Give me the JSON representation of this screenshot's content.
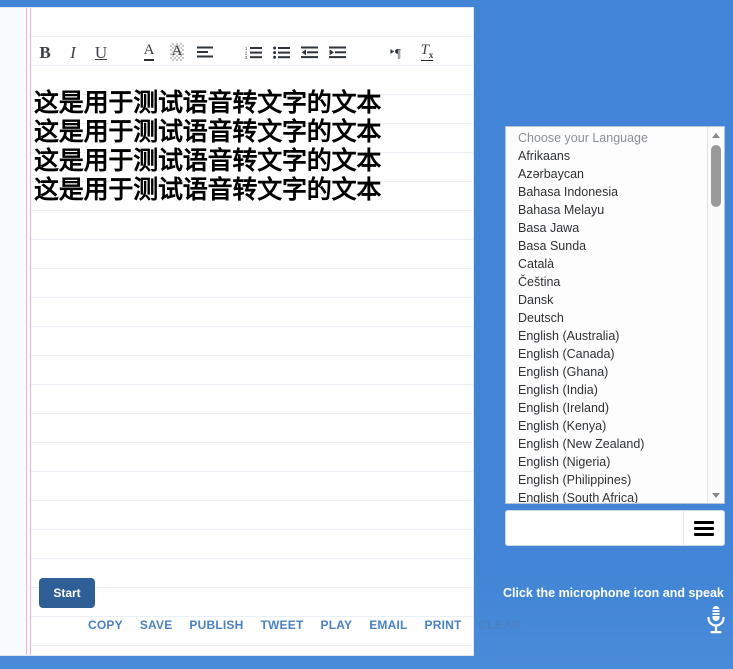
{
  "theme": {
    "background_blue": "#4285d6",
    "start_button_blue": "#2f5f97",
    "link_blue": "#4a82c4",
    "margin_line_pink": "#efb8c8",
    "rule_line": "#e9eff4"
  },
  "toolbar": {
    "buttons": [
      {
        "name": "bold-icon",
        "label": "B",
        "title": "Bold"
      },
      {
        "name": "italic-icon",
        "label": "I",
        "title": "Italic"
      },
      {
        "name": "underline-icon",
        "label": "U",
        "title": "Underline"
      },
      {
        "name": "text-color-icon",
        "label": "A",
        "title": "Text Color"
      },
      {
        "name": "highlight-color-icon",
        "label": "A",
        "title": "Highlight Color"
      },
      {
        "name": "align-icon",
        "label": "",
        "title": "Align"
      },
      {
        "name": "ordered-list-icon",
        "label": "",
        "title": "Numbered List"
      },
      {
        "name": "unordered-list-icon",
        "label": "",
        "title": "Bulleted List"
      },
      {
        "name": "outdent-icon",
        "label": "",
        "title": "Decrease Indent"
      },
      {
        "name": "indent-icon",
        "label": "",
        "title": "Increase Indent"
      },
      {
        "name": "text-direction-icon",
        "label": "¶",
        "title": "Text Direction"
      },
      {
        "name": "remove-format-icon",
        "label": "Tx",
        "title": "Remove Formatting"
      }
    ]
  },
  "document": {
    "lines": [
      "这是用于测试语音转文字的文本",
      "这是用于测试语音转文字的文本",
      "这是用于测试语音转文字的文本",
      "这是用于测试语音转文字的文本"
    ]
  },
  "controls": {
    "start_label": "Start",
    "actions": [
      {
        "name": "copy",
        "label": "COPY"
      },
      {
        "name": "save",
        "label": "SAVE"
      },
      {
        "name": "publish",
        "label": "PUBLISH"
      },
      {
        "name": "tweet",
        "label": "TWEET"
      },
      {
        "name": "play",
        "label": "PLAY"
      },
      {
        "name": "email",
        "label": "EMAIL"
      },
      {
        "name": "print",
        "label": "PRINT"
      },
      {
        "name": "clear",
        "label": "CLEAR"
      }
    ]
  },
  "language_list": {
    "placeholder_label": "Choose your Language",
    "items": [
      "Afrikaans",
      "Azərbaycan",
      "Bahasa Indonesia",
      "Bahasa Melayu",
      "Basa Jawa",
      "Basa Sunda",
      "Català",
      "Čeština",
      "Dansk",
      "Deutsch",
      "English (Australia)",
      "English (Canada)",
      "English (Ghana)",
      "English (India)",
      "English (Ireland)",
      "English (Kenya)",
      "English (New Zealand)",
      "English (Nigeria)",
      "English (Philippines)",
      "English (South Africa)"
    ]
  },
  "speech": {
    "input_value": "",
    "input_placeholder": "",
    "menu_icon": "hamburger-menu-icon",
    "hint_text": "Click the microphone icon and speak",
    "mic_icon": "microphone-icon"
  }
}
